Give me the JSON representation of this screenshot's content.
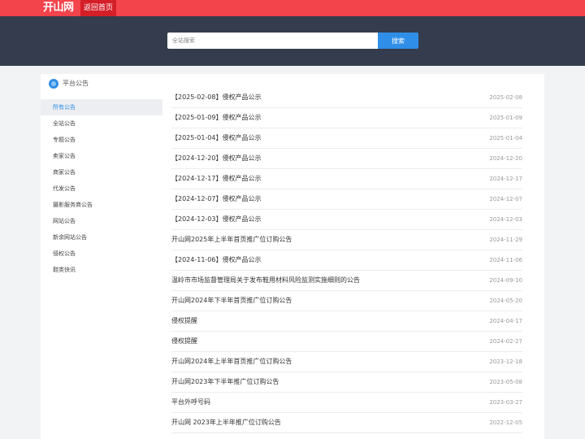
{
  "header": {
    "logo_text": "开山网",
    "home_link": "返回首页"
  },
  "search": {
    "placeholder": "全站搜索",
    "button": "搜索"
  },
  "colors": {
    "topbar": "#f3434b",
    "home_link_bg": "#d41f28",
    "search_band": "#353c4d",
    "accent": "#2f8fe8"
  },
  "sidebar": {
    "title": "平台公告",
    "icon": "announcement-icon",
    "items": [
      {
        "label": "所有公告",
        "active": true
      },
      {
        "label": "全站公告",
        "active": false
      },
      {
        "label": "专题公告",
        "active": false
      },
      {
        "label": "卖家公告",
        "active": false
      },
      {
        "label": "商家公告",
        "active": false
      },
      {
        "label": "代发公告",
        "active": false
      },
      {
        "label": "摄影服务商公告",
        "active": false
      },
      {
        "label": "网站公告",
        "active": false
      },
      {
        "label": "新余网站公告",
        "active": false
      },
      {
        "label": "侵权公告",
        "active": false
      },
      {
        "label": "鞋类快讯",
        "active": false
      }
    ]
  },
  "notices": [
    {
      "title": "【2025-02-08】侵权产品公示",
      "date": "2025-02-08"
    },
    {
      "title": "【2025-01-09】侵权产品公示",
      "date": "2025-01-09"
    },
    {
      "title": "【2025-01-04】侵权产品公示",
      "date": "2025-01-04"
    },
    {
      "title": "【2024-12-20】侵权产品公示",
      "date": "2024-12-20"
    },
    {
      "title": "【2024-12-17】侵权产品公示",
      "date": "2024-12-17"
    },
    {
      "title": "【2024-12-07】侵权产品公示",
      "date": "2024-12-07"
    },
    {
      "title": "【2024-12-03】侵权产品公示",
      "date": "2024-12-03"
    },
    {
      "title": "开山网2025年上半年首页推广位订购公告",
      "date": "2024-11-29"
    },
    {
      "title": "【2024-11-06】侵权产品公示",
      "date": "2024-11-06"
    },
    {
      "title": "温岭市市场监督管理局关于发布鞋用材料风险监测实施细则的公告",
      "date": "2024-09-10"
    },
    {
      "title": "开山网2024年下半年首页推广位订购公告",
      "date": "2024-05-20"
    },
    {
      "title": "侵权提醒",
      "date": "2024-04-17"
    },
    {
      "title": "侵权提醒",
      "date": "2024-02-27"
    },
    {
      "title": "开山网2024年上半年首页推广位订购公告",
      "date": "2023-12-18"
    },
    {
      "title": "开山网2023年下半年推广位订购公告",
      "date": "2023-05-08"
    },
    {
      "title": "平台外呼号码",
      "date": "2023-03-27"
    },
    {
      "title": "开山网 2023年上半年推广位订购公告",
      "date": "2022-12-05"
    }
  ]
}
